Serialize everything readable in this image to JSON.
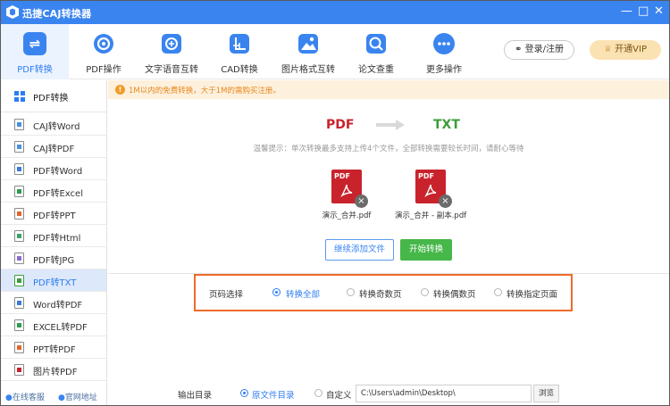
{
  "app": {
    "title": "迅捷CAJ转换器"
  },
  "toolbar": {
    "items": [
      {
        "label": "PDF转换",
        "icon": "pdf-convert-icon"
      },
      {
        "label": "PDF操作",
        "icon": "gear-icon"
      },
      {
        "label": "文字语音互转",
        "icon": "speech-text-icon"
      },
      {
        "label": "CAD转换",
        "icon": "cad-icon"
      },
      {
        "label": "图片格式互转",
        "icon": "image-icon"
      },
      {
        "label": "论文查重",
        "icon": "paper-check-icon"
      },
      {
        "label": "更多操作",
        "icon": "more-icon"
      }
    ],
    "login": "登录/注册",
    "vip": "开通VIP"
  },
  "sidebar": {
    "header": "PDF转换",
    "items": [
      {
        "label": "CAJ转Word"
      },
      {
        "label": "CAJ转PDF"
      },
      {
        "label": "PDF转Word"
      },
      {
        "label": "PDF转Excel"
      },
      {
        "label": "PDF转PPT"
      },
      {
        "label": "PDF转Html"
      },
      {
        "label": "PDF转JPG"
      },
      {
        "label": "PDF转TXT"
      },
      {
        "label": "Word转PDF"
      },
      {
        "label": "EXCEL转PDF"
      },
      {
        "label": "PPT转PDF"
      },
      {
        "label": "图片转PDF"
      }
    ],
    "footer_service": "在线客服",
    "footer_site": "官网地址"
  },
  "main": {
    "notice": "1M以内的免费转换，大于1M的需购买注册。",
    "from": "PDF",
    "to": "TXT",
    "hint": "温馨提示：单次转换最多支持上传4个文件，全部转换需要较长时间，请耐心等待",
    "files": [
      {
        "name": "演示_合并.pdf",
        "badge": "PDF"
      },
      {
        "name": "演示_合并 - 副本.pdf",
        "badge": "PDF"
      }
    ],
    "add_button": "继续添加文件",
    "start_button": "开始转换",
    "page_select": {
      "label": "页码选择",
      "options": [
        "转换全部",
        "转换奇数页",
        "转换偶数页",
        "转换指定页面"
      ],
      "selected": "转换全部"
    },
    "output": {
      "label": "输出目录",
      "option_source": "原文件目录",
      "option_custom": "自定义",
      "path": "C:\\Users\\admin\\Desktop\\",
      "browse": "浏览"
    }
  },
  "colors": {
    "accent": "#3a84f0",
    "green": "#46b749",
    "orange": "#ef6b2a",
    "pdf_red": "#c8232c",
    "txt_green": "#3f9b3c"
  }
}
